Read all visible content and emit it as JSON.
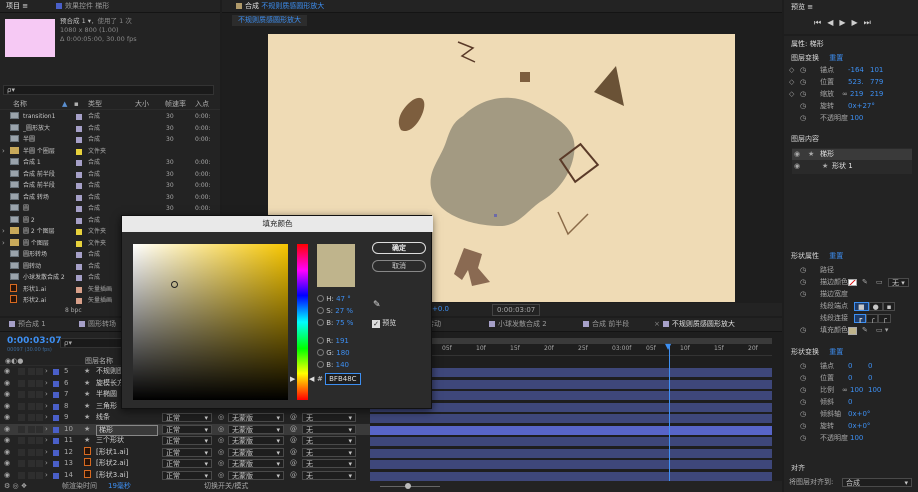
{
  "project_panel": {
    "tab_project": "项目",
    "tab_effects": "效果控件 梯形",
    "comp_name": "预合成 1",
    "comp_used": "，使用了 1 次",
    "comp_size": "1080 x 800 (1.00)",
    "comp_duration": "Δ 0:00:05:00, 30.00 fps",
    "search_placeholder": "ρ▾",
    "col_name": "名称",
    "col_type": "类型",
    "col_size": "大小",
    "col_fps": "帧速率",
    "col_in": "入点",
    "bpc": "8 bpc",
    "items": [
      {
        "name": "transition1",
        "type": "合成",
        "fps": "30",
        "in": "0:00:",
        "icon": "comp",
        "color": "#a6a0c8"
      },
      {
        "name": "_圆形放大",
        "type": "合成",
        "fps": "30",
        "in": "0:00:",
        "icon": "comp",
        "color": "#a6a0c8"
      },
      {
        "name": "半圆",
        "type": "合成",
        "fps": "30",
        "in": "0:00:",
        "icon": "comp",
        "color": "#a6a0c8"
      },
      {
        "name": "半圆 个圈层",
        "type": "文件夹",
        "fps": "",
        "in": "",
        "icon": "folder",
        "color": "#e8d23c"
      },
      {
        "name": "合成 1",
        "type": "合成",
        "fps": "30",
        "in": "0:00:",
        "icon": "comp",
        "color": "#a6a0c8"
      },
      {
        "name": "合成 前半段",
        "type": "合成",
        "fps": "30",
        "in": "0:00:",
        "icon": "comp",
        "color": "#a6a0c8"
      },
      {
        "name": "合成 前半段",
        "type": "合成",
        "fps": "30",
        "in": "0:00:",
        "icon": "comp",
        "color": "#a6a0c8"
      },
      {
        "name": "合成 转场",
        "type": "合成",
        "fps": "30",
        "in": "0:00:",
        "icon": "comp",
        "color": "#a6a0c8"
      },
      {
        "name": "圆",
        "type": "合成",
        "fps": "30",
        "in": "0:00:",
        "icon": "comp",
        "color": "#a6a0c8"
      },
      {
        "name": "圆 2",
        "type": "合成",
        "fps": "30",
        "in": "0:00:",
        "icon": "comp",
        "color": "#a6a0c8"
      },
      {
        "name": "圆 2 个图层",
        "type": "文件夹",
        "fps": "",
        "in": "",
        "icon": "folder",
        "color": "#e8d23c"
      },
      {
        "name": "圆 个图层",
        "type": "文件夹",
        "fps": "",
        "in": "",
        "icon": "folder",
        "color": "#e8d23c"
      },
      {
        "name": "圆形转场",
        "type": "合成",
        "fps": "30",
        "in": "0:00:",
        "icon": "comp",
        "color": "#a6a0c8"
      },
      {
        "name": "圆转动",
        "type": "合成",
        "fps": "30",
        "in": "0:00:",
        "icon": "comp",
        "color": "#a6a0c8"
      },
      {
        "name": "小球发散合成 2",
        "type": "合成",
        "fps": "30",
        "in": "0:00:",
        "icon": "comp",
        "color": "#a6a0c8"
      },
      {
        "name": "形状1.ai",
        "type": "矢量插画",
        "fps": "",
        "in": "",
        "icon": "ai",
        "color": "#d8a08a"
      },
      {
        "name": "形状2.ai",
        "type": "矢量插画",
        "fps": "",
        "in": "",
        "icon": "ai",
        "color": "#d8a08a"
      }
    ]
  },
  "comp_viewer": {
    "tab_label": "合成",
    "tab_name": "不规则质感圆形放大",
    "breadcrumb": "不规则质感圆形放大",
    "offset": "+0.0",
    "timecode": "0:00:03:07"
  },
  "color_dialog": {
    "title": "填充颜色",
    "ok": "确定",
    "cancel": "取消",
    "preview_label": "预览",
    "h_label": "H:",
    "h_value": "47 °",
    "s_label": "S:",
    "s_value": "27 %",
    "b_label": "B:",
    "b_value": "75 %",
    "r_label": "R:",
    "r_value": "191",
    "g_label": "G:",
    "g_value": "180",
    "b2_label": "B:",
    "b2_value": "140",
    "hash": "#",
    "hex": "BFB48C",
    "color": "#bfb48c"
  },
  "timeline": {
    "tabs": [
      {
        "label": "预合成 1",
        "color": "#a6a0c8"
      },
      {
        "label": "圆形转场",
        "color": "#a6a0c8"
      },
      {
        "label": "圆转动",
        "color": "#a6a0c8"
      },
      {
        "label": "小球发散合成 2",
        "color": "#a6a0c8"
      },
      {
        "label": "合成 前半段",
        "color": "#a6a0c8"
      },
      {
        "label": "不规则质感圆形放大",
        "color": "#a6a0c8"
      }
    ],
    "timecode": "0:00:03:07",
    "timecode_sub": "00097 (30.00 fps)",
    "col_name": "图层名称",
    "ruler": [
      "00f",
      "05f",
      "10f",
      "15f",
      "20f",
      "25f",
      "03:00f",
      "05f",
      "10f",
      "15f",
      "20f"
    ],
    "footer_render": "帧渲染时间",
    "footer_ms": "19毫秒",
    "footer_switch": "切换开关/模式",
    "layers": [
      {
        "num": "5",
        "name": "不规则图形1",
        "mode": "",
        "track": "",
        "parent": "",
        "icon": "star",
        "color": "#4a5fc8"
      },
      {
        "num": "6",
        "name": "旋模长方形",
        "mode": "",
        "track": "",
        "parent": "",
        "icon": "star",
        "color": "#4a5fc8"
      },
      {
        "num": "7",
        "name": "半椭圆",
        "mode": "",
        "track": "",
        "parent": "",
        "icon": "star",
        "color": "#4a5fc8"
      },
      {
        "num": "8",
        "name": "三角形",
        "mode": "",
        "track": "",
        "parent": "",
        "icon": "star",
        "color": "#4a5fc8"
      },
      {
        "num": "9",
        "name": "线条",
        "mode": "正常",
        "track": "无蒙版",
        "parent": "无",
        "icon": "star",
        "color": "#4a5fc8"
      },
      {
        "num": "10",
        "name": "梯形",
        "mode": "正常",
        "track": "无蒙版",
        "parent": "无",
        "icon": "star",
        "color": "#4a5fc8"
      },
      {
        "num": "11",
        "name": "三个形状",
        "mode": "正常",
        "track": "无蒙版",
        "parent": "无",
        "icon": "star",
        "color": "#4a5fc8"
      },
      {
        "num": "12",
        "name": "[形状1.ai]",
        "mode": "正常",
        "track": "无蒙版",
        "parent": "无",
        "icon": "ai",
        "color": "#4a5fc8"
      },
      {
        "num": "13",
        "name": "[形状2.ai]",
        "mode": "正常",
        "track": "无蒙版",
        "parent": "无",
        "icon": "ai",
        "color": "#4a5fc8"
      },
      {
        "num": "14",
        "name": "[形状3.ai]",
        "mode": "正常",
        "track": "无蒙版",
        "parent": "无",
        "icon": "ai",
        "color": "#4a5fc8"
      }
    ]
  },
  "preview_panel": {
    "title": "预览"
  },
  "properties": {
    "title": "属性: 梯形",
    "transform_title": "图层变换",
    "reset": "重置",
    "anchor_label": "锚点",
    "anchor_x": "-164",
    "anchor_y": "101",
    "position_label": "位置",
    "position_x": "523.",
    "position_y": "779",
    "scale_label": "缩放",
    "scale_x": "219",
    "scale_y": "219",
    "rotation_label": "旋转",
    "rotation": "0x+27°",
    "opacity_label": "不透明度",
    "opacity": "100",
    "contents_title": "图层内容",
    "content_group": "梯形",
    "content_shape": "形状 1",
    "shape_props_title": "形状属性",
    "shape_reset": "重置",
    "path_label": "路径",
    "stroke_color_label": "描边颜色",
    "stroke_none": "无",
    "stroke_width_label": "描边宽度",
    "line_join_label": "线段端点",
    "line_cap_label": "线段连接",
    "fill_color_label": "填充颜色",
    "fill_color": "#bfb48c",
    "shape_transform_title": "形状变换",
    "st_reset": "重置",
    "st_anchor_label": "锚点",
    "st_anchor_x": "0",
    "st_anchor_y": "0",
    "st_position_label": "位置",
    "st_position_x": "0",
    "st_position_y": "0",
    "st_scale_label": "比例",
    "st_scale_x": "100",
    "st_scale_y": "100",
    "st_skew_label": "倾斜",
    "st_skew": "0",
    "st_skew_axis_label": "倾斜轴",
    "st_skew_axis": "0x+0°",
    "st_rotation_label": "旋转",
    "st_rotation": "0x+0°",
    "st_opacity_label": "不透明度",
    "st_opacity": "100",
    "align_title": "对齐",
    "align_to_label": "将图层对齐到:",
    "align_to_value": "合成"
  }
}
